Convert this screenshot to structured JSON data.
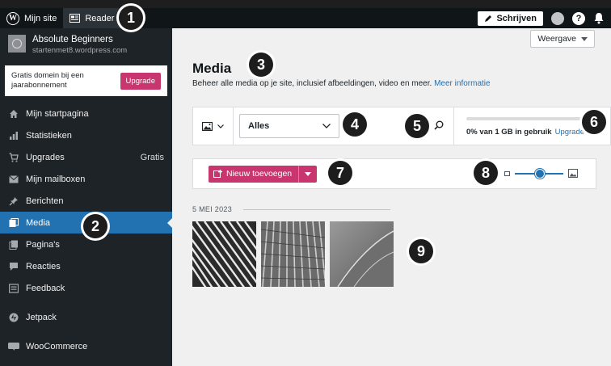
{
  "topbar": {
    "site_label": "Mijn site",
    "reader_label": "Reader",
    "write_label": "Schrijven"
  },
  "site": {
    "name": "Absolute Beginners",
    "url": "startenmet8.wordpress.com"
  },
  "promo": {
    "text": "Gratis domein bij een jaarabonnement",
    "button": "Upgrade"
  },
  "menu": [
    {
      "label": "Mijn startpagina",
      "icon": "home-icon"
    },
    {
      "label": "Statistieken",
      "icon": "stats-icon"
    },
    {
      "label": "Upgrades",
      "icon": "cart-icon",
      "extra": "Gratis"
    },
    {
      "label": "Mijn mailboxen",
      "icon": "mail-icon"
    },
    {
      "label": "Berichten",
      "icon": "pin-icon"
    },
    {
      "label": "Media",
      "icon": "media-icon",
      "active": true
    },
    {
      "label": "Pagina's",
      "icon": "pages-icon"
    },
    {
      "label": "Reacties",
      "icon": "comment-icon"
    },
    {
      "label": "Feedback",
      "icon": "feedback-icon"
    },
    {
      "label": "Jetpack",
      "icon": "jetpack-icon"
    },
    {
      "label": "WooCommerce",
      "icon": "woo-icon"
    }
  ],
  "main": {
    "view_button": "Weergave",
    "title": "Media",
    "subtitle": "Beheer alle media op je site, inclusief afbeeldingen, video en meer.",
    "more_link": "Meer informatie",
    "filter_value": "Alles",
    "storage_text": "0% van 1 GB in gebruik",
    "storage_upgrade": "Upgrade",
    "storage_used_fraction": 0.0,
    "add_button": "Nieuw toevoegen",
    "date_group": "5 MEI 2023"
  },
  "badges": [
    "1",
    "2",
    "3",
    "4",
    "5",
    "6",
    "7",
    "8",
    "9"
  ],
  "colors": {
    "accent": "#2271b1",
    "brand_pink": "#c9356e",
    "sidebar_bg": "#1d2327"
  }
}
